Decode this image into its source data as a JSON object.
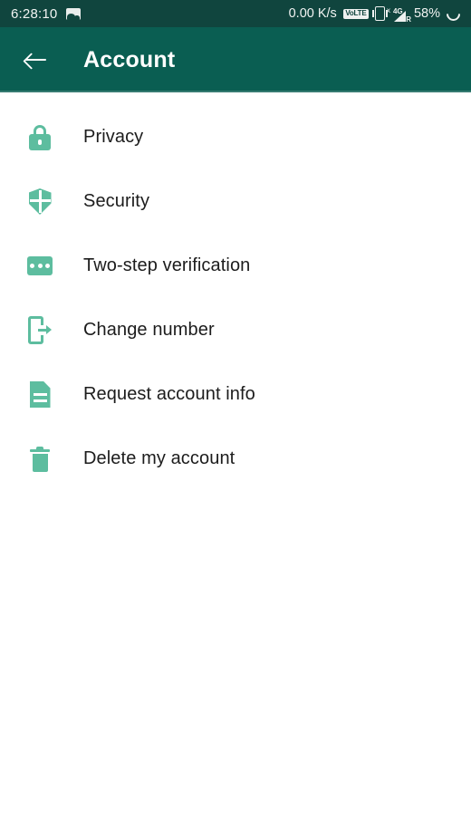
{
  "status_bar": {
    "clock": "6:28:10",
    "gallery_icon": "gallery-icon",
    "net_speed": "0.00 K/s",
    "volte_label": "VoLTE",
    "vibrate_icon": "vibrate-icon",
    "signal_tech": "4G",
    "signal_roaming": "R",
    "signal_nosim": "x",
    "battery": "58%",
    "sync_icon": "sync-icon",
    "background_color": "#10453e",
    "text_color": "#f2f4f3"
  },
  "app_bar": {
    "back_icon": "back-arrow-icon",
    "title": "Account",
    "background_color": "#0a5e52",
    "title_color": "#ffffff"
  },
  "theme": {
    "icon_color": "#5dbd9f",
    "list_text_color": "#1c1c1c",
    "page_background": "#ffffff"
  },
  "settings_list": {
    "items": [
      {
        "label": "Privacy",
        "icon": "lock-icon"
      },
      {
        "label": "Security",
        "icon": "shield-icon"
      },
      {
        "label": "Two-step verification",
        "icon": "dots-card-icon"
      },
      {
        "label": "Change number",
        "icon": "phone-exit-icon"
      },
      {
        "label": "Request account info",
        "icon": "document-icon"
      },
      {
        "label": "Delete my account",
        "icon": "trash-icon"
      }
    ]
  }
}
